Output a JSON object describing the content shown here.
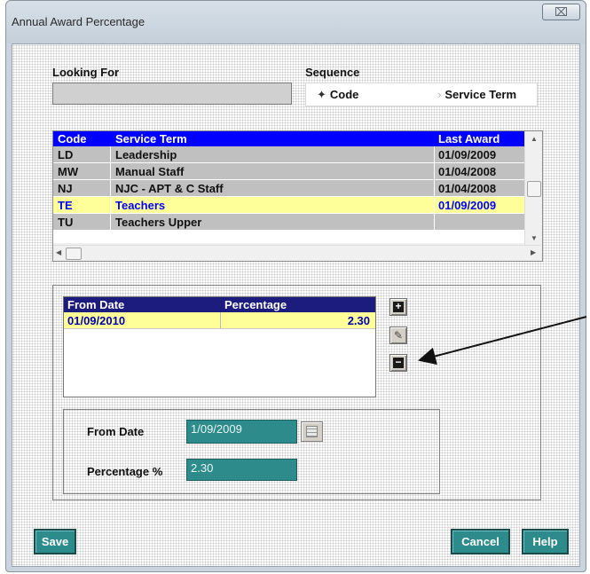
{
  "window": {
    "title": "Annual Award Percentage",
    "close_glyph": "⌧"
  },
  "search": {
    "label": "Looking For",
    "value": ""
  },
  "sequence": {
    "label": "Sequence",
    "options": [
      {
        "label": "Code",
        "selected": true
      },
      {
        "label": "Service Term",
        "selected": false
      }
    ]
  },
  "service_grid": {
    "columns": [
      "Code",
      "Service Term",
      "Last Award"
    ],
    "rows": [
      {
        "code": "LD",
        "term": "Leadership",
        "last_award": "01/09/2009",
        "selected": false
      },
      {
        "code": "MW",
        "term": "Manual Staff",
        "last_award": "01/04/2008",
        "selected": false
      },
      {
        "code": "NJ",
        "term": "NJC - APT & C Staff",
        "last_award": "01/04/2008",
        "selected": false
      },
      {
        "code": "TE",
        "term": "Teachers",
        "last_award": "01/09/2009",
        "selected": true
      },
      {
        "code": "TU",
        "term": "Teachers Upper",
        "last_award": "",
        "selected": false
      }
    ]
  },
  "award_grid": {
    "columns": [
      "From Date",
      "Percentage"
    ],
    "rows": [
      {
        "from_date": "01/09/2010",
        "percentage": "2.30"
      }
    ]
  },
  "toolbar": {
    "add_icon": "plus-icon",
    "edit_icon": "pencil-icon",
    "delete_icon": "minus-icon"
  },
  "form": {
    "from_date_label": "From Date",
    "from_date_value": "1/09/2009",
    "percentage_label": "Percentage %",
    "percentage_value": "2.30"
  },
  "buttons": {
    "save": "Save",
    "cancel": "Cancel",
    "help": "Help"
  },
  "colors": {
    "grid_header": "#0000ff",
    "selected_row": "#ffff99",
    "teal": "#2e8b8b",
    "award_header": "#1c1c7e"
  }
}
